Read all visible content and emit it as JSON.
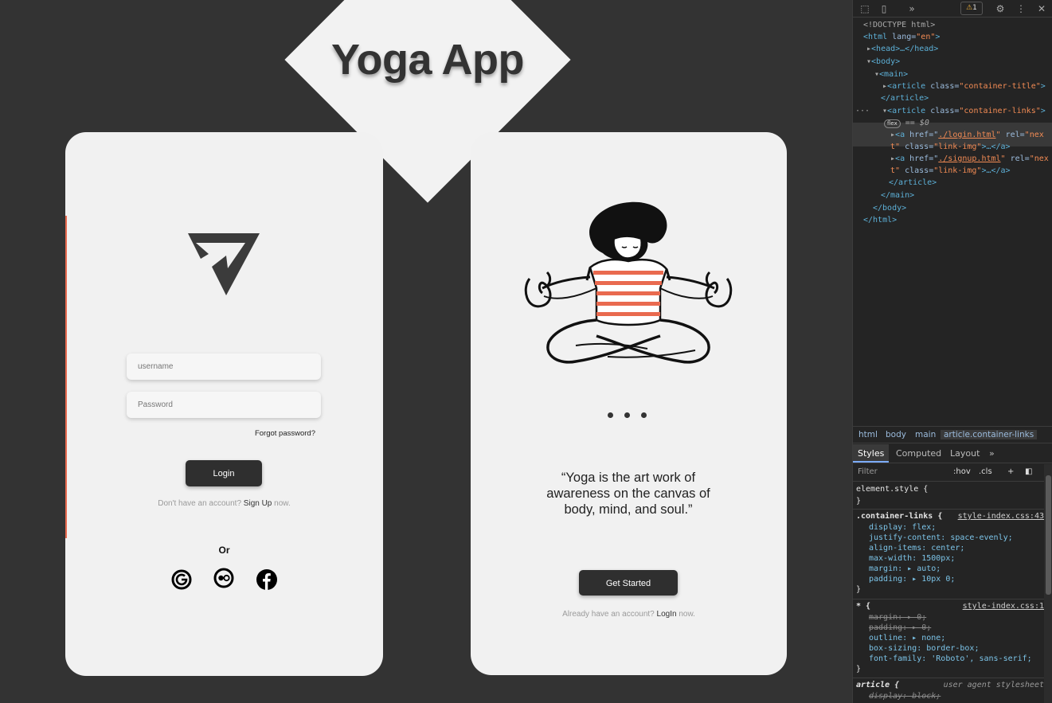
{
  "page": {
    "title": "Yoga App",
    "login_card": {
      "username_placeholder": "username",
      "password_placeholder": "Password",
      "forgot_password": "Forgot password?",
      "login_button": "Login",
      "signup_prefix": "Don't have an account?",
      "signup_link": "Sign Up",
      "signup_suffix": "now.",
      "or_label": "Or",
      "social_icons": [
        "google-icon",
        "flickr-icon",
        "facebook-icon"
      ]
    },
    "intro_card": {
      "quote": "“Yoga is the art work of awareness on the canvas of body, mind, and soul.”",
      "start_button": "Get Started",
      "login_prefix": "Already have an account?",
      "login_link": "LogIn",
      "login_suffix": "now."
    },
    "colors": {
      "background": "#333333",
      "card": "#f1f1f1",
      "button": "#2f2f2f",
      "stripe": "#e96a4f"
    }
  },
  "devtools": {
    "warning_count": "1",
    "dom": {
      "doctype": "<!DOCTYPE html>",
      "html_open_tag": "html",
      "html_attr_name": "lang",
      "html_attr_value": "\"en\"",
      "head": "<head>…</head>",
      "body_open": "<body>",
      "main_open": "<main>",
      "article_tag": "article",
      "class_attr": "class",
      "title_class": "\"container-title\"",
      "article_close": "</article>",
      "links_class": "\"container-links\"",
      "flex_badge": "flex",
      "selected_marker": "== $0",
      "link_tag": "a",
      "href_attr": "href",
      "login_href": "./login.html",
      "signup_href": "./signup.html",
      "rel_attr": "rel",
      "rel_value_start": "\"nex",
      "rel_value_end": "t\"",
      "link_class_value": "\"link-img\"",
      "link_close": ">…</a>",
      "main_close": "</main>",
      "body_close": "</body>",
      "html_close": "</html>"
    },
    "breadcrumbs": [
      "html",
      "body",
      "main",
      "article.container-links"
    ],
    "tabs": [
      "Styles",
      "Computed",
      "Layout"
    ],
    "filter_placeholder": "Filter",
    "hov": ":hov",
    "cls": ".cls",
    "rules": {
      "element_style": "element.style {",
      "close_brace": "}",
      "container_links_selector": ".container-links {",
      "container_links_source": "style-index.css:43",
      "display": "display: flex;",
      "justify": "justify-content: space-evenly;",
      "align": "align-items: center;",
      "max_width": "max-width: 1500px;",
      "margin": "margin: ▸ auto;",
      "padding": "padding: ▸ 10px 0;",
      "universal_selector": "* {",
      "universal_source": "style-index.css:1",
      "margin_zero": "margin: ▸ 0;",
      "padding_zero": "padding: ▸ 0;",
      "outline": "outline: ▸ none;",
      "box_sizing": "box-sizing: border-box;",
      "font_family": "font-family: 'Roboto', sans-serif;",
      "article_selector": "article {",
      "ua_label": "user agent stylesheet",
      "display_block": "display: block;"
    }
  }
}
